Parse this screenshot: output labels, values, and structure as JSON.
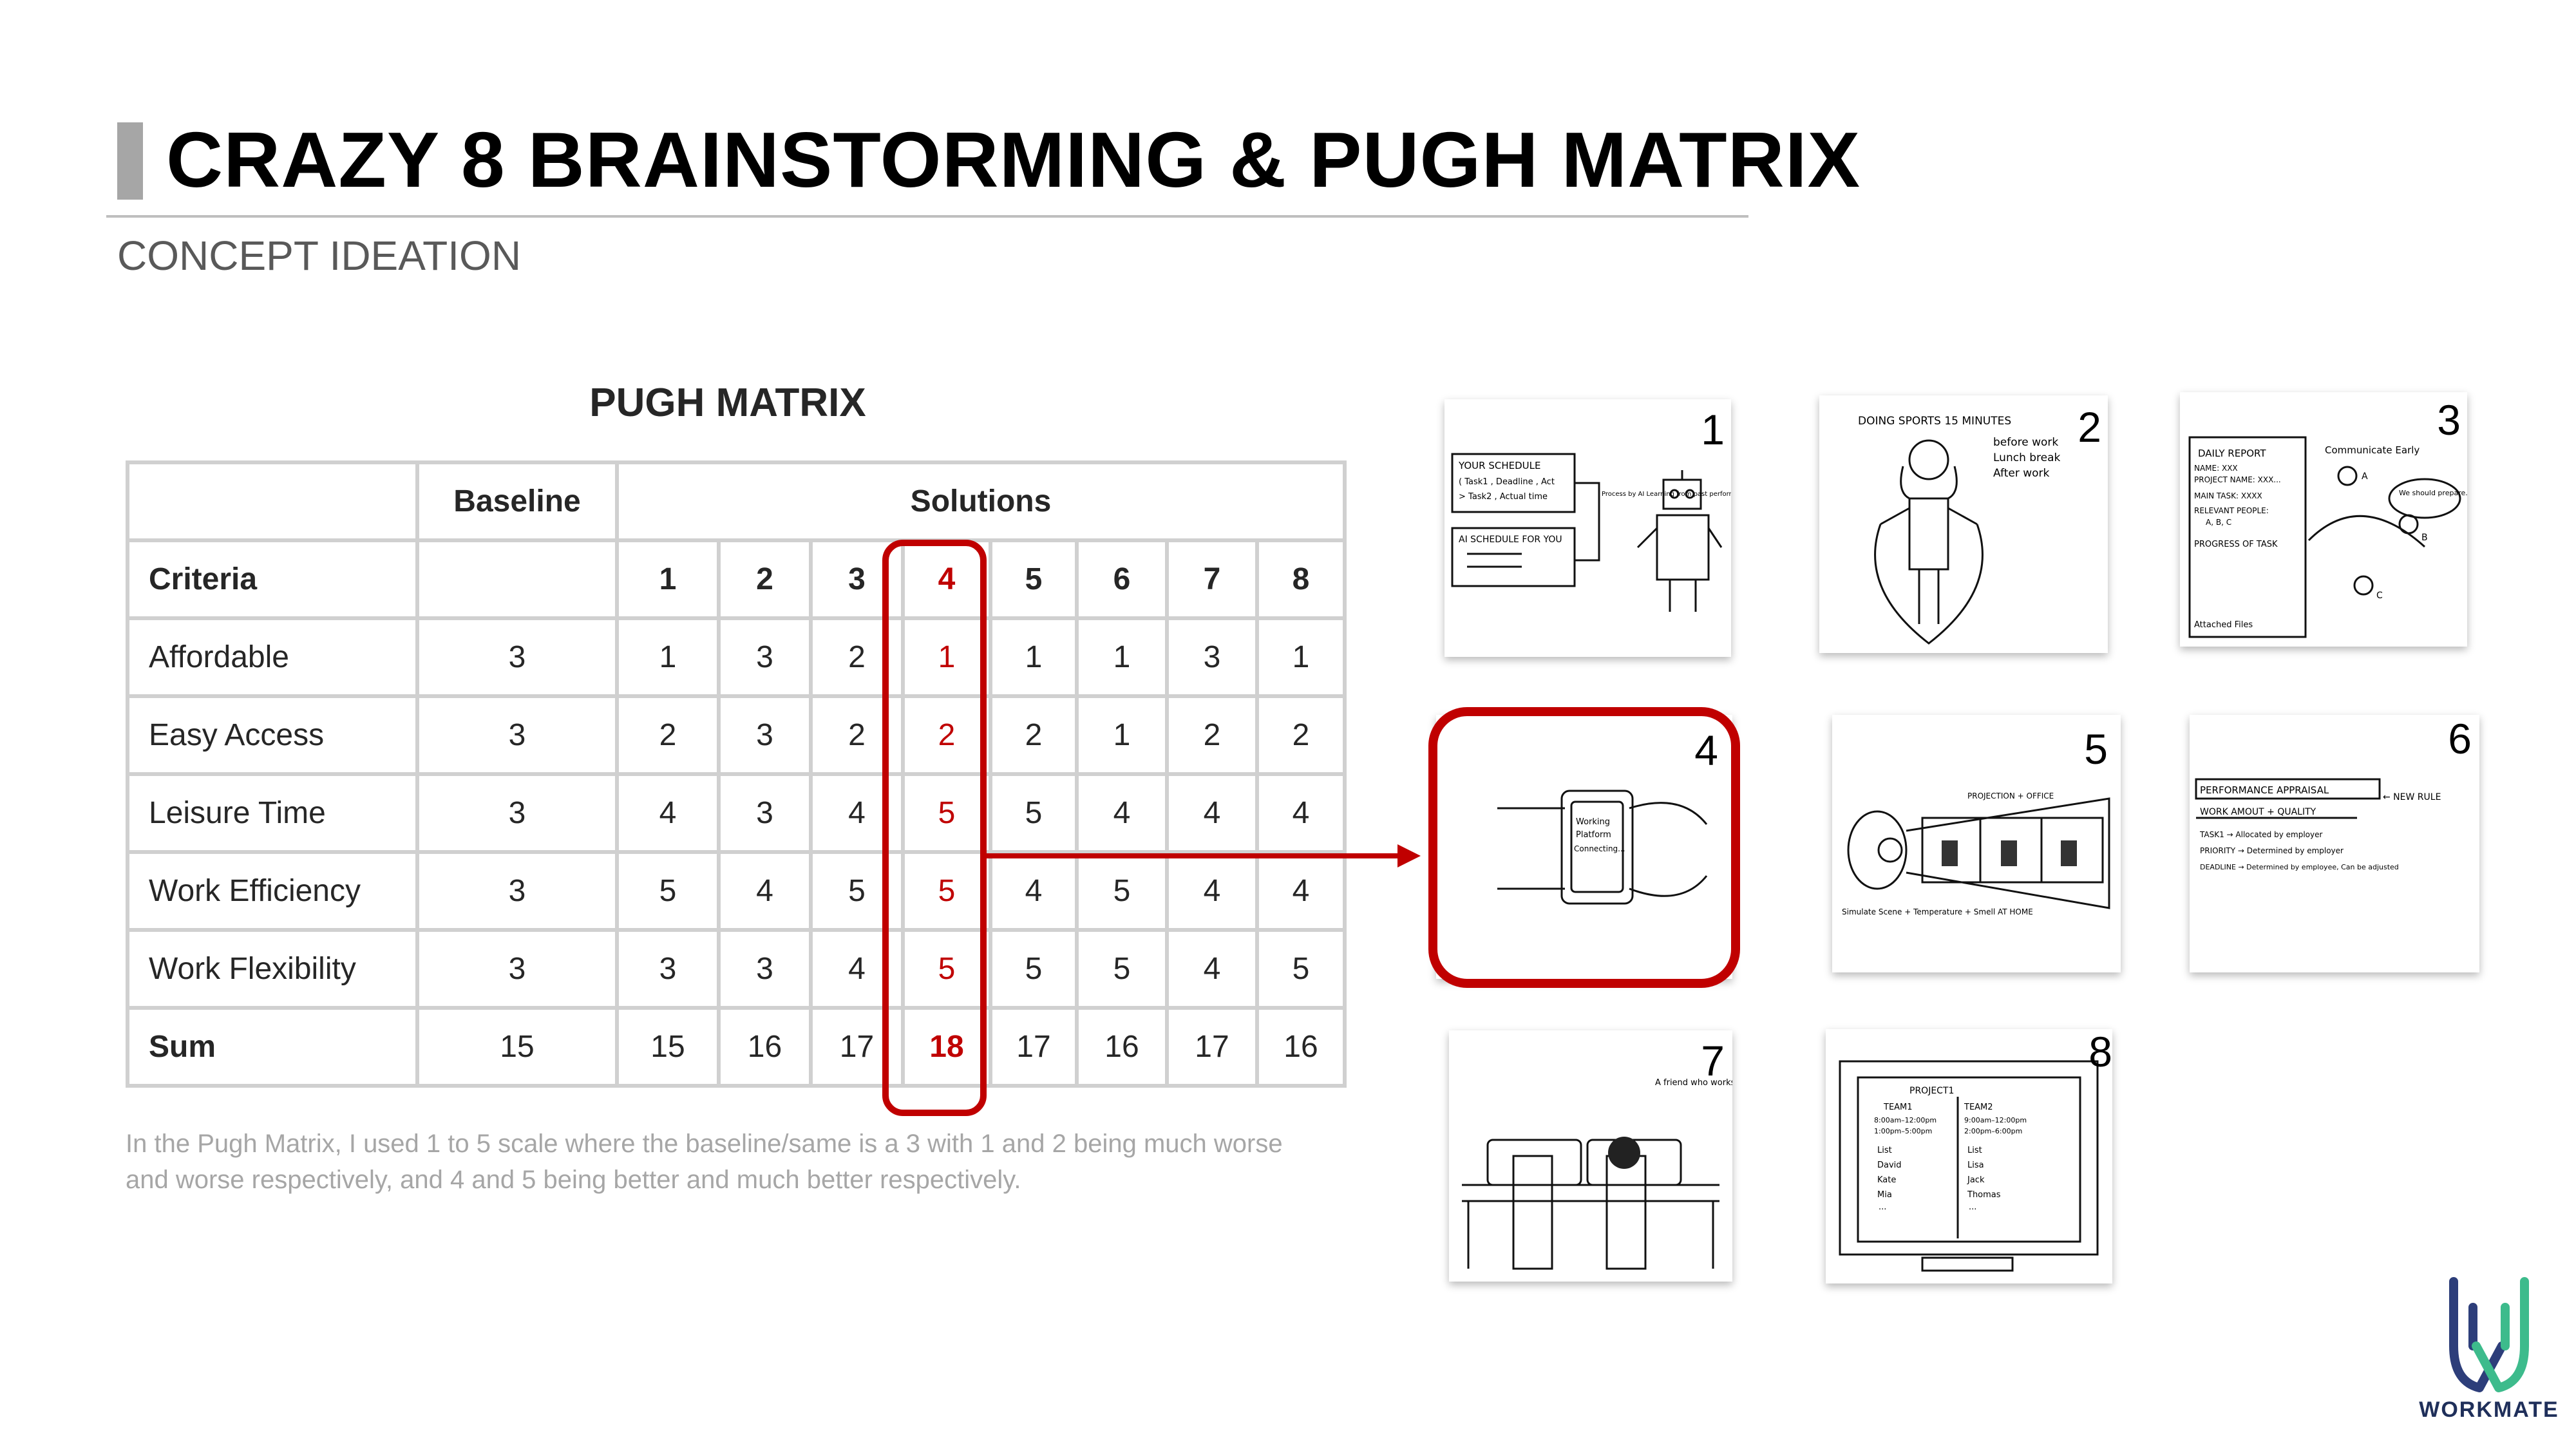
{
  "header": {
    "title": "CRAZY 8 BRAINSTORMING & PUGH MATRIX",
    "subtitle": "CONCEPT IDEATION"
  },
  "pugh": {
    "title": "PUGH MATRIX",
    "baseline_label": "Baseline",
    "solutions_label": "Solutions",
    "criteria_label": "Criteria",
    "solution_numbers": [
      "1",
      "2",
      "3",
      "4",
      "5",
      "6",
      "7",
      "8"
    ],
    "rows": [
      {
        "label": "Affordable",
        "baseline": "3",
        "scores": [
          "1",
          "3",
          "2",
          "1",
          "1",
          "1",
          "3",
          "1"
        ]
      },
      {
        "label": "Easy Access",
        "baseline": "3",
        "scores": [
          "2",
          "3",
          "2",
          "2",
          "2",
          "1",
          "2",
          "2"
        ]
      },
      {
        "label": "Leisure Time",
        "baseline": "3",
        "scores": [
          "4",
          "3",
          "4",
          "5",
          "5",
          "4",
          "4",
          "4"
        ]
      },
      {
        "label": "Work Efficiency",
        "baseline": "3",
        "scores": [
          "5",
          "4",
          "5",
          "5",
          "4",
          "5",
          "4",
          "4"
        ]
      },
      {
        "label": "Work Flexibility",
        "baseline": "3",
        "scores": [
          "3",
          "3",
          "4",
          "5",
          "5",
          "5",
          "4",
          "5"
        ]
      }
    ],
    "sum": {
      "label": "Sum",
      "baseline": "15",
      "scores": [
        "15",
        "16",
        "17",
        "18",
        "17",
        "16",
        "17",
        "16"
      ]
    },
    "note": "In the Pugh Matrix, I used 1 to 5 scale where the baseline/same is a 3 with 1 and 2 being much worse and worse respectively, and 4 and 5 being better and much better respectively.",
    "highlight_color": "#c00000"
  },
  "sketches": {
    "numbers": [
      "1",
      "2",
      "3",
      "4",
      "5",
      "6",
      "7",
      "8"
    ],
    "s1": {
      "schedule": "YOUR SCHEDULE",
      "line1": "( Task1 , Deadline , Act",
      "line2": "> Task2 , Actual time",
      "ai": "AI SCHEDULE FOR YOU",
      "process": "Process by AI Learning from past performance"
    },
    "s2": {
      "line1": "DOING SPORTS 15 MINUTES",
      "line2": "before work",
      "line3": "Lunch break",
      "line4": "After work"
    },
    "s3": {
      "report": "DAILY REPORT",
      "name": "NAME: XXX",
      "project": "PROJECT NAME: XXX...",
      "main": "MAIN TASK: XXXX",
      "relevant": "RELEVANT PEOPLE:",
      "abc": "A, B, C",
      "progress": "PROGRESS OF TASK",
      "attached": "Attached Files",
      "communicate": "Communicate Early",
      "bubble": "We should prepare...",
      "a": "A",
      "b": "B",
      "c": "C"
    },
    "s4": {
      "l1": "Working",
      "l2": "Platform",
      "l3": "Connecting..."
    },
    "s5": {
      "projection": "PROJECTION + OFFICE",
      "simulate": "Simulate Scene + Temperature + Smell  AT HOME"
    },
    "s6": {
      "pa": "PERFORMANCE APPRAISAL",
      "rule": "← NEW RULE",
      "wq": "WORK AMOUT + QUALITY",
      "task": "TASK1 → Allocated by employer",
      "priority": "PRIORITY → Determined by employer",
      "deadline": "DEADLINE → Determined by employee, Can be adjusted"
    },
    "s7": {
      "friend": "A friend who works remotely"
    },
    "s8": {
      "project": "PROJECT1",
      "team1": "TEAM1",
      "team2": "TEAM2",
      "t1a": "8:00am–12:00pm",
      "t1b": "1:00pm–5:00pm",
      "t2a": "9:00am–12:00pm",
      "t2b": "2:00pm–6:00pm",
      "list": "List",
      "n1": "David",
      "n2": "Kate",
      "n3": "Mia",
      "n4": "Lisa",
      "n5": "Jack",
      "n6": "Thomas",
      "dots": "..."
    }
  },
  "logo": {
    "text": "WORKMATE",
    "colors": [
      "#2d3e7a",
      "#3dbb8c"
    ]
  }
}
